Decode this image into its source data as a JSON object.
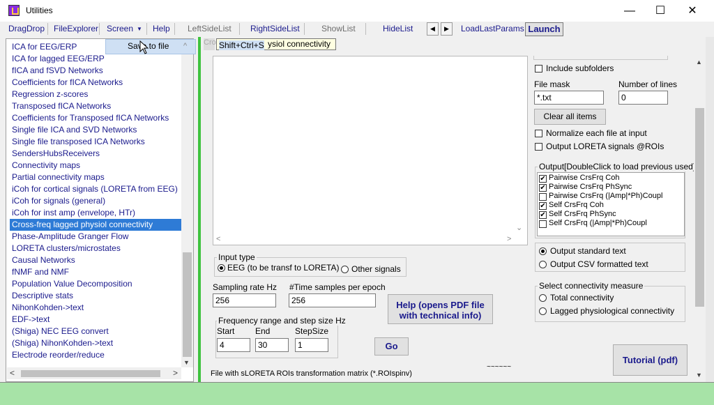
{
  "window": {
    "title": "Utilities"
  },
  "titlebar": {
    "minimize": "—",
    "maximize": "☐",
    "close": "✕"
  },
  "menu": {
    "dragdrop": "DragDrop",
    "fileexplorer": "FileExplorer",
    "screen": "Screen",
    "screen_arrow": "▼",
    "help": "Help",
    "leftsidelist": "LeftSideList",
    "rightsidelist": "RightSideList",
    "showlist": "ShowList",
    "hidelist": "HideList",
    "prev_arrow": "◀",
    "next_arrow": "▶",
    "loadlastparams": "LoadLastParams",
    "launch": "Launch"
  },
  "sidebar": {
    "items": [
      "ICA for EEG/ERP",
      "ICA for lagged EEG/ERP",
      "fICA and fSVD Networks",
      "Coefficients for fICA Networks",
      "Regression z-scores",
      "Transposed fICA Networks",
      "Coefficients for Transposed fICA Networks",
      "Single file ICA and SVD Networks",
      "Single file transposed ICA Networks",
      "SendersHubsReceivers",
      "Connectivity maps",
      "Partial connectivity maps",
      "iCoh for cortical signals (LORETA from EEG)",
      "iCoh for signals (general)",
      "iCoh for inst amp (envelope, HTr)",
      "Cross-freq lagged physiol connectivity",
      "Phase-Amplitude Granger Flow",
      "LORETA clusters/microstates",
      "Causal Networks",
      "fNMF and NMF",
      "Population Value Decomposition",
      "Descriptive stats",
      "NihonKohden->text",
      "EDF->text",
      "(Shiga) NEC EEG convert",
      "(Shiga) NihonKohden->text",
      "Electrode reorder/reduce"
    ],
    "selected_index": 15,
    "scroll_up": "▲",
    "scroll_down": "▼",
    "scroll_left": "<",
    "scroll_right": ">"
  },
  "popup": {
    "label": "Save to file",
    "chevron": "^"
  },
  "tooltip": {
    "shortcut": "Shift+Ctrl+S",
    "tab_partial": "Cro",
    "tab_text": "ysiol connectivity"
  },
  "input_type": {
    "title": "Input type",
    "eeg": "EEG (to be transf to LORETA)",
    "other": "Other signals"
  },
  "sampling": {
    "label": "Sampling rate Hz",
    "value": "256"
  },
  "samples": {
    "label": "#Time samples per epoch",
    "value": "256"
  },
  "help_button": {
    "line1": "Help (opens PDF file",
    "line2": "with technical info)"
  },
  "frequency": {
    "title": "Frequency range and step size Hz",
    "start_label": "Start",
    "end_label": "End",
    "step_label": "StepSize",
    "start": "4",
    "end": "30",
    "step": "1"
  },
  "go_button": "Go",
  "roi_file": {
    "label": "File with sLORETA ROIs transformation matrix (*.ROIspinv)",
    "tilde": "~~~~~~"
  },
  "right_panel": {
    "include_subfolders": "Include subfolders",
    "file_mask_label": "File mask",
    "file_mask": "*.txt",
    "lines_label": "Number of lines",
    "lines": "0",
    "clear_all": "Clear all items",
    "normalize": "Normalize each file at input",
    "output_loreta": "Output LORETA signals @ROIs",
    "output_group": "Output[DoubleClick to load previous used]",
    "outputs": [
      {
        "label": "Pairwise CrsFrq Coh",
        "checked": true
      },
      {
        "label": "Pairwise CrsFrq PhSync",
        "checked": true
      },
      {
        "label": "Pairwise CrsFrq (|Amp|*Ph)Coupl",
        "checked": false
      },
      {
        "label": "Self CrsFrq Coh",
        "checked": true
      },
      {
        "label": "Self CrsFrq PhSync",
        "checked": true
      },
      {
        "label": "Self CrsFrq (|Amp|*Ph)Coupl",
        "checked": false
      }
    ],
    "check_mark": "✔",
    "output_standard": "Output standard text",
    "output_csv": "Output CSV formatted text",
    "measure_title": "Select connectivity measure",
    "total": "Total connectivity",
    "lagged": "Lagged physiological connectivity",
    "tutorial": "Tutorial (pdf)"
  },
  "memo_scroll": {
    "down": "⌄",
    "left": "<",
    "right": ">"
  }
}
